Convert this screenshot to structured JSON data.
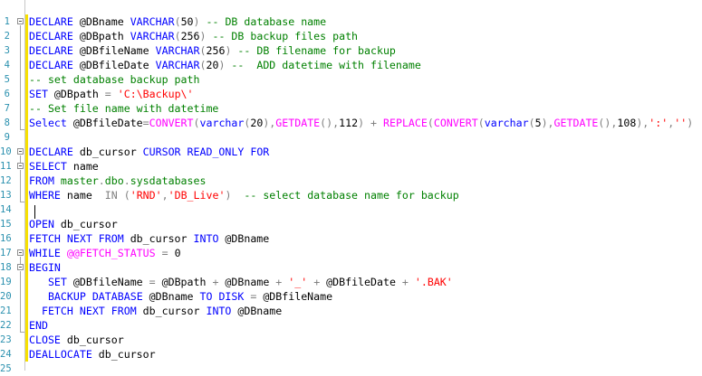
{
  "line_numbers": [
    "1",
    "2",
    "3",
    "4",
    "5",
    "6",
    "7",
    "8",
    "9",
    "10",
    "11",
    "12",
    "13",
    "14",
    "15",
    "16",
    "17",
    "18",
    "19",
    "20",
    "21",
    "22",
    "23",
    "24",
    "25"
  ],
  "lines": [
    [
      {
        "t": "kw",
        "s": "DECLARE"
      },
      {
        "t": "",
        "s": " @DBname "
      },
      {
        "t": "kw",
        "s": "VARCHAR"
      },
      {
        "t": "op",
        "s": "("
      },
      {
        "t": "",
        "s": "50"
      },
      {
        "t": "op",
        "s": ")"
      },
      {
        "t": "",
        "s": " "
      },
      {
        "t": "cm",
        "s": "-- DB database name"
      }
    ],
    [
      {
        "t": "kw",
        "s": "DECLARE"
      },
      {
        "t": "",
        "s": " @DBpath "
      },
      {
        "t": "kw",
        "s": "VARCHAR"
      },
      {
        "t": "op",
        "s": "("
      },
      {
        "t": "",
        "s": "256"
      },
      {
        "t": "op",
        "s": ")"
      },
      {
        "t": "",
        "s": " "
      },
      {
        "t": "cm",
        "s": "-- DB backup files path"
      }
    ],
    [
      {
        "t": "kw",
        "s": "DECLARE"
      },
      {
        "t": "",
        "s": " @DBfileName "
      },
      {
        "t": "kw",
        "s": "VARCHAR"
      },
      {
        "t": "op",
        "s": "("
      },
      {
        "t": "",
        "s": "256"
      },
      {
        "t": "op",
        "s": ")"
      },
      {
        "t": "",
        "s": " "
      },
      {
        "t": "cm",
        "s": "-- DB filename for backup"
      }
    ],
    [
      {
        "t": "kw",
        "s": "DECLARE"
      },
      {
        "t": "",
        "s": " @DBfileDate "
      },
      {
        "t": "kw",
        "s": "VARCHAR"
      },
      {
        "t": "op",
        "s": "("
      },
      {
        "t": "",
        "s": "20"
      },
      {
        "t": "op",
        "s": ")"
      },
      {
        "t": "",
        "s": " "
      },
      {
        "t": "cm",
        "s": "--  ADD datetime with filename"
      }
    ],
    [
      {
        "t": "cm",
        "s": "-- set database backup path"
      }
    ],
    [
      {
        "t": "kw",
        "s": "SET"
      },
      {
        "t": "",
        "s": " @DBpath "
      },
      {
        "t": "op",
        "s": "="
      },
      {
        "t": "",
        "s": " "
      },
      {
        "t": "str",
        "s": "'C:\\Backup\\'"
      }
    ],
    [
      {
        "t": "cm",
        "s": "-- Set file name with datetime"
      }
    ],
    [
      {
        "t": "kw",
        "s": "Select"
      },
      {
        "t": "",
        "s": " @DBfileDate"
      },
      {
        "t": "op",
        "s": "="
      },
      {
        "t": "fn",
        "s": "CONVERT"
      },
      {
        "t": "op",
        "s": "("
      },
      {
        "t": "kw",
        "s": "varchar"
      },
      {
        "t": "op",
        "s": "("
      },
      {
        "t": "",
        "s": "20"
      },
      {
        "t": "op",
        "s": "),"
      },
      {
        "t": "fn",
        "s": "GETDATE"
      },
      {
        "t": "op",
        "s": "(),"
      },
      {
        "t": "",
        "s": "112"
      },
      {
        "t": "op",
        "s": ")"
      },
      {
        "t": "",
        "s": " "
      },
      {
        "t": "op",
        "s": "+"
      },
      {
        "t": "",
        "s": " "
      },
      {
        "t": "fn",
        "s": "REPLACE"
      },
      {
        "t": "op",
        "s": "("
      },
      {
        "t": "fn",
        "s": "CONVERT"
      },
      {
        "t": "op",
        "s": "("
      },
      {
        "t": "kw",
        "s": "varchar"
      },
      {
        "t": "op",
        "s": "("
      },
      {
        "t": "",
        "s": "5"
      },
      {
        "t": "op",
        "s": "),"
      },
      {
        "t": "fn",
        "s": "GETDATE"
      },
      {
        "t": "op",
        "s": "(),"
      },
      {
        "t": "",
        "s": "108"
      },
      {
        "t": "op",
        "s": "),"
      },
      {
        "t": "str",
        "s": "':'"
      },
      {
        "t": "op",
        "s": ","
      },
      {
        "t": "str",
        "s": "''"
      },
      {
        "t": "op",
        "s": ")"
      }
    ],
    [],
    [
      {
        "t": "kw",
        "s": "DECLARE"
      },
      {
        "t": "",
        "s": " db_cursor "
      },
      {
        "t": "kw",
        "s": "CURSOR"
      },
      {
        "t": "",
        "s": " "
      },
      {
        "t": "kw",
        "s": "READ_ONLY"
      },
      {
        "t": "",
        "s": " "
      },
      {
        "t": "kw",
        "s": "FOR"
      }
    ],
    [
      {
        "t": "kw",
        "s": "SELECT"
      },
      {
        "t": "",
        "s": " name"
      }
    ],
    [
      {
        "t": "kw",
        "s": "FROM"
      },
      {
        "t": "",
        "s": " "
      },
      {
        "t": "sys",
        "s": "master"
      },
      {
        "t": "op",
        "s": "."
      },
      {
        "t": "sys",
        "s": "dbo"
      },
      {
        "t": "op",
        "s": "."
      },
      {
        "t": "sys",
        "s": "sysdatabases"
      }
    ],
    [
      {
        "t": "kw",
        "s": "WHERE"
      },
      {
        "t": "",
        "s": " name  "
      },
      {
        "t": "op",
        "s": "IN"
      },
      {
        "t": "",
        "s": " "
      },
      {
        "t": "op",
        "s": "("
      },
      {
        "t": "str",
        "s": "'RND'"
      },
      {
        "t": "op",
        "s": ","
      },
      {
        "t": "str",
        "s": "'DB_Live'"
      },
      {
        "t": "op",
        "s": ")"
      },
      {
        "t": "",
        "s": "  "
      },
      {
        "t": "cm",
        "s": "-- select database name for backup"
      }
    ],
    [],
    [
      {
        "t": "kw",
        "s": "OPEN"
      },
      {
        "t": "",
        "s": " db_cursor"
      }
    ],
    [
      {
        "t": "kw",
        "s": "FETCH"
      },
      {
        "t": "",
        "s": " "
      },
      {
        "t": "kw",
        "s": "NEXT"
      },
      {
        "t": "",
        "s": " "
      },
      {
        "t": "kw",
        "s": "FROM"
      },
      {
        "t": "",
        "s": " db_cursor "
      },
      {
        "t": "kw",
        "s": "INTO"
      },
      {
        "t": "",
        "s": " @DBname"
      }
    ],
    [
      {
        "t": "kw",
        "s": "WHILE"
      },
      {
        "t": "",
        "s": " "
      },
      {
        "t": "fn",
        "s": "@@FETCH_STATUS"
      },
      {
        "t": "",
        "s": " "
      },
      {
        "t": "op",
        "s": "="
      },
      {
        "t": "",
        "s": " 0"
      }
    ],
    [
      {
        "t": "kw",
        "s": "BEGIN"
      }
    ],
    [
      {
        "t": "",
        "s": "   "
      },
      {
        "t": "kw",
        "s": "SET"
      },
      {
        "t": "",
        "s": " @DBfileName "
      },
      {
        "t": "op",
        "s": "="
      },
      {
        "t": "",
        "s": " @DBpath "
      },
      {
        "t": "op",
        "s": "+"
      },
      {
        "t": "",
        "s": " @DBname "
      },
      {
        "t": "op",
        "s": "+"
      },
      {
        "t": "",
        "s": " "
      },
      {
        "t": "str",
        "s": "'_'"
      },
      {
        "t": "",
        "s": " "
      },
      {
        "t": "op",
        "s": "+"
      },
      {
        "t": "",
        "s": " @DBfileDate "
      },
      {
        "t": "op",
        "s": "+"
      },
      {
        "t": "",
        "s": " "
      },
      {
        "t": "str",
        "s": "'.BAK'"
      }
    ],
    [
      {
        "t": "",
        "s": "   "
      },
      {
        "t": "kw",
        "s": "BACKUP"
      },
      {
        "t": "",
        "s": " "
      },
      {
        "t": "kw",
        "s": "DATABASE"
      },
      {
        "t": "",
        "s": " @DBname "
      },
      {
        "t": "kw",
        "s": "TO"
      },
      {
        "t": "",
        "s": " "
      },
      {
        "t": "kw",
        "s": "DISK"
      },
      {
        "t": "",
        "s": " "
      },
      {
        "t": "op",
        "s": "="
      },
      {
        "t": "",
        "s": " @DBfileName"
      }
    ],
    [
      {
        "t": "",
        "s": "  "
      },
      {
        "t": "kw",
        "s": "FETCH"
      },
      {
        "t": "",
        "s": " "
      },
      {
        "t": "kw",
        "s": "NEXT"
      },
      {
        "t": "",
        "s": " "
      },
      {
        "t": "kw",
        "s": "FROM"
      },
      {
        "t": "",
        "s": " db_cursor "
      },
      {
        "t": "kw",
        "s": "INTO"
      },
      {
        "t": "",
        "s": " @DBname"
      }
    ],
    [
      {
        "t": "kw",
        "s": "END"
      }
    ],
    [
      {
        "t": "kw",
        "s": "CLOSE"
      },
      {
        "t": "",
        "s": " db_cursor"
      }
    ],
    [
      {
        "t": "kw",
        "s": "DEALLOCATE"
      },
      {
        "t": "",
        "s": " db_cursor"
      }
    ]
  ],
  "colors": {
    "keyword": "#0000ff",
    "function": "#ff00ff",
    "string": "#ff0000",
    "comment": "#008000",
    "operator": "#808080",
    "line_number": "#2b91af",
    "change_marker": "#f7e000"
  }
}
